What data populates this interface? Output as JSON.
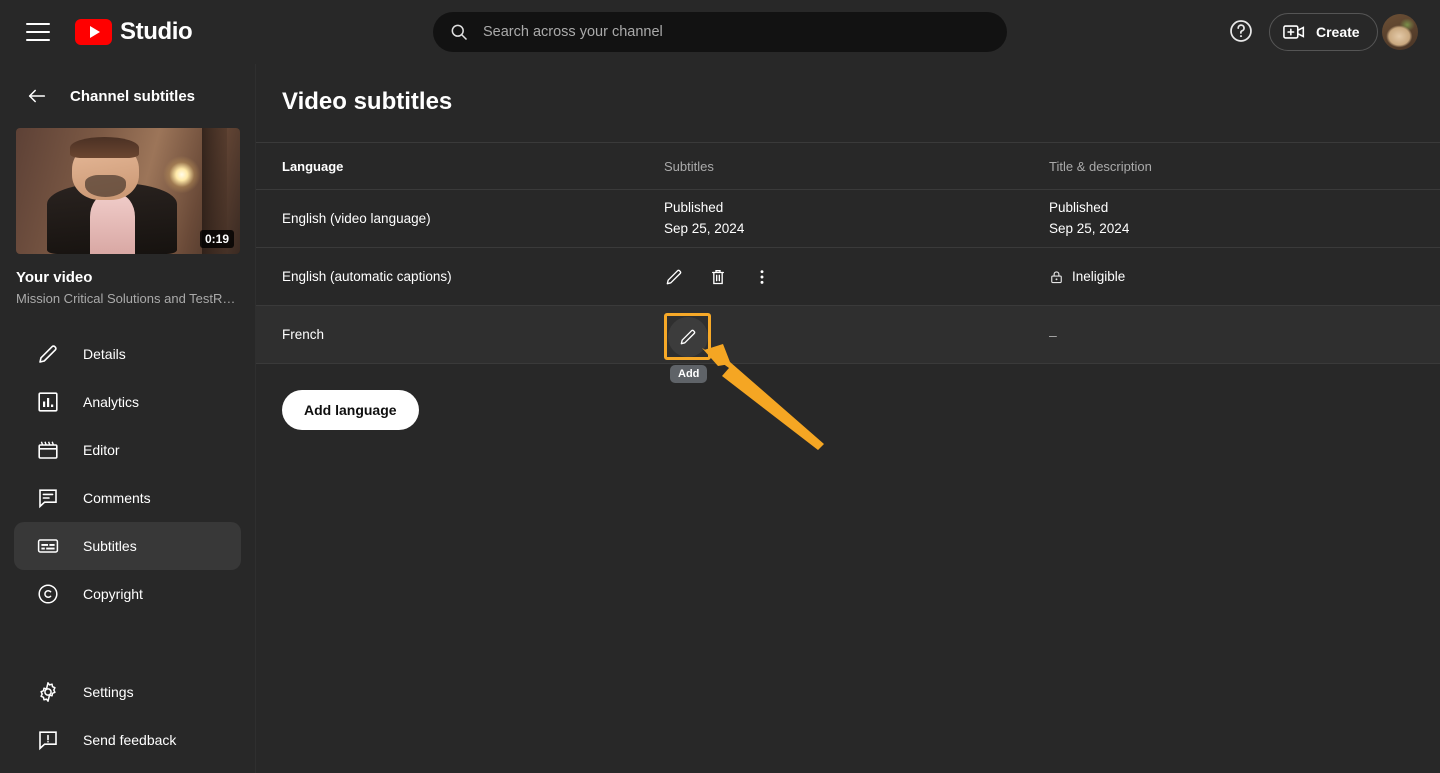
{
  "header": {
    "menu_label": "Menu",
    "brand": "Studio",
    "search": {
      "placeholder": "Search across your channel",
      "value": ""
    },
    "help_label": "Help",
    "create_label": "Create",
    "avatar_label": "Account"
  },
  "sidebar": {
    "back_title": "Channel subtitles",
    "video": {
      "duration": "0:19",
      "title": "Your video",
      "description": "Mission Critical Solutions and TestR…"
    },
    "items": [
      {
        "label": "Details",
        "icon": "pencil-icon",
        "active": false
      },
      {
        "label": "Analytics",
        "icon": "analytics-icon",
        "active": false
      },
      {
        "label": "Editor",
        "icon": "editor-icon",
        "active": false
      },
      {
        "label": "Comments",
        "icon": "comments-icon",
        "active": false
      },
      {
        "label": "Subtitles",
        "icon": "subtitles-icon",
        "active": true
      },
      {
        "label": "Copyright",
        "icon": "copyright-icon",
        "active": false
      }
    ],
    "bottom_items": [
      {
        "label": "Settings",
        "icon": "gear-icon"
      },
      {
        "label": "Send feedback",
        "icon": "feedback-icon"
      }
    ]
  },
  "main": {
    "page_title": "Video subtitles",
    "table": {
      "headers": {
        "language": "Language",
        "subtitles": "Subtitles",
        "title_description": "Title & description"
      },
      "rows": [
        {
          "language": "English (video language)",
          "subtitles_status": "Published",
          "subtitles_date": "Sep 25, 2024",
          "title_status": "Published",
          "title_date": "Sep 25, 2024",
          "type": "published"
        },
        {
          "language": "English (automatic captions)",
          "actions": [
            "edit-icon",
            "delete-icon",
            "more-options-icon"
          ],
          "title_status": "Ineligible",
          "type": "actions"
        },
        {
          "language": "French",
          "title_status": "–",
          "type": "add"
        }
      ]
    },
    "add_language_label": "Add language"
  },
  "annotation": {
    "tooltip": "Add",
    "highlight_color": "#f7a928",
    "arrow_color": "#f5a623"
  }
}
